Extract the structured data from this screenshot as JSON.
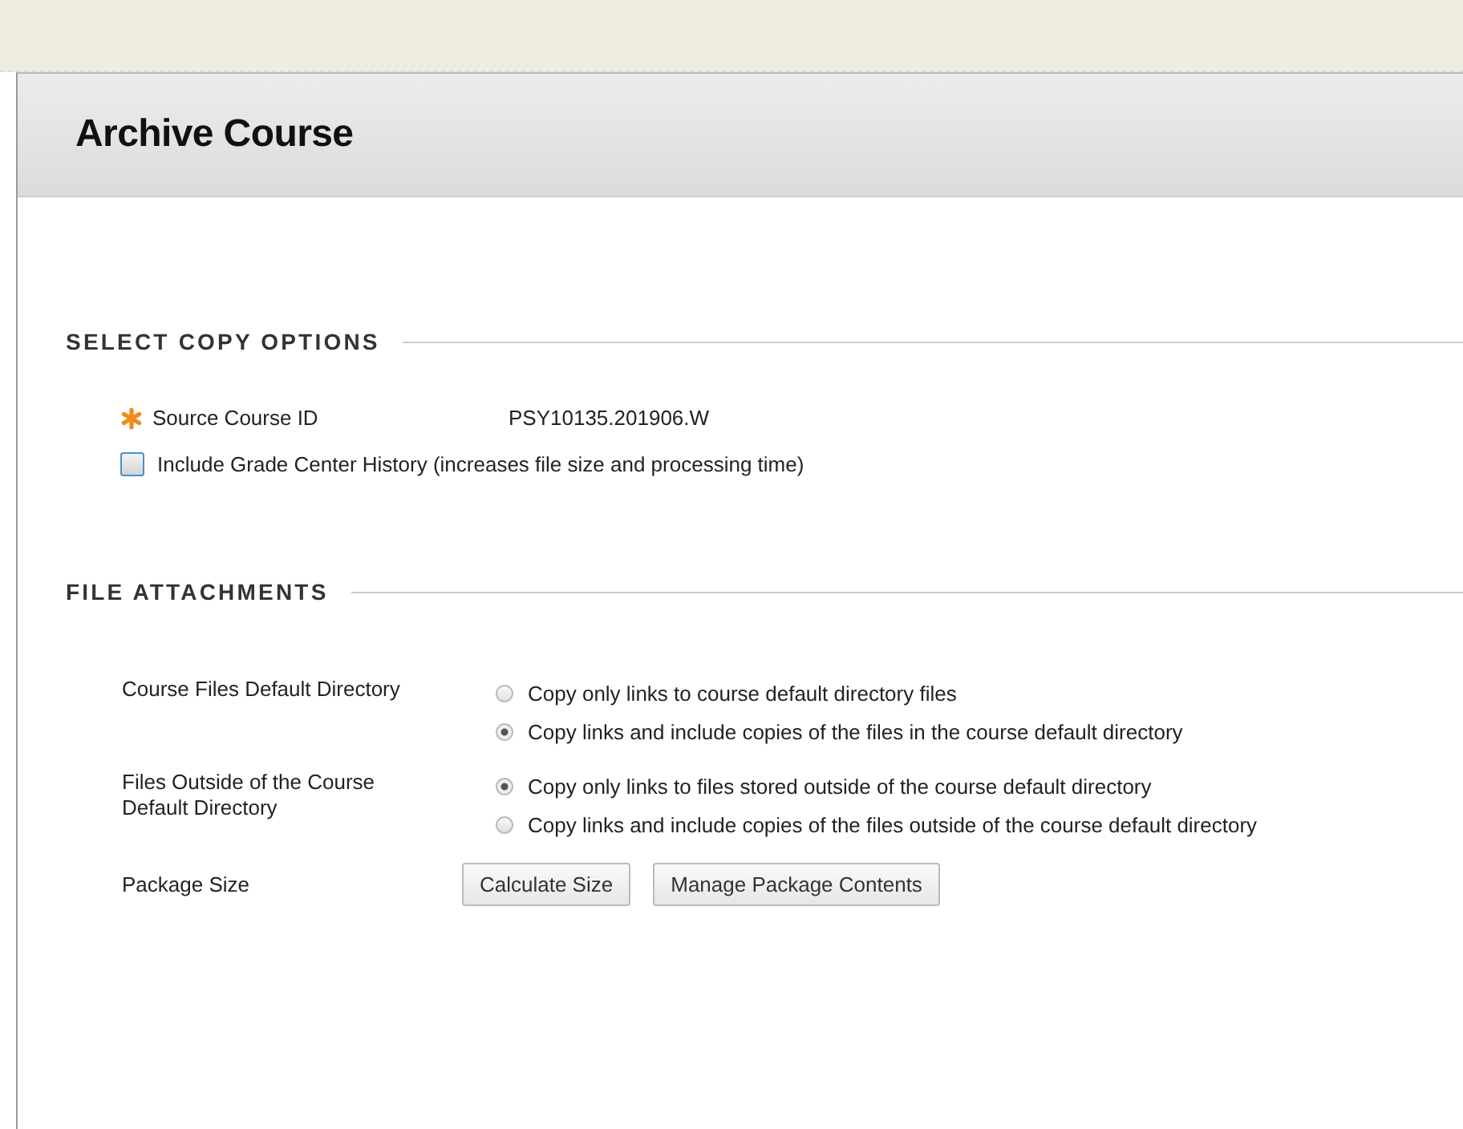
{
  "page_title": "Archive Course",
  "sections": [
    {
      "title": "SELECT COPY OPTIONS",
      "kind": "copy",
      "source": {
        "label": "Source Course ID",
        "required": true,
        "value": "PSY10135.201906.W"
      },
      "checkbox": {
        "label": "Include Grade Center History (increases file size and processing time)",
        "checked": false
      }
    },
    {
      "title": "FILE ATTACHMENTS",
      "kind": "files",
      "groups": [
        {
          "label": "Course Files Default Directory",
          "options": [
            {
              "label": "Copy only links to course default directory files",
              "selected": false
            },
            {
              "label": "Copy links and include copies of the files in the course default directory",
              "selected": true
            }
          ]
        },
        {
          "label": "Files Outside of the Course Default Directory",
          "options": [
            {
              "label": "Copy only links to files stored outside of the course default directory",
              "selected": true
            },
            {
              "label": "Copy links and include copies of the files outside of the course default directory",
              "selected": false
            }
          ]
        }
      ],
      "package": {
        "label": "Package Size",
        "buttons": [
          "Calculate Size",
          "Manage Package Contents"
        ]
      }
    }
  ]
}
